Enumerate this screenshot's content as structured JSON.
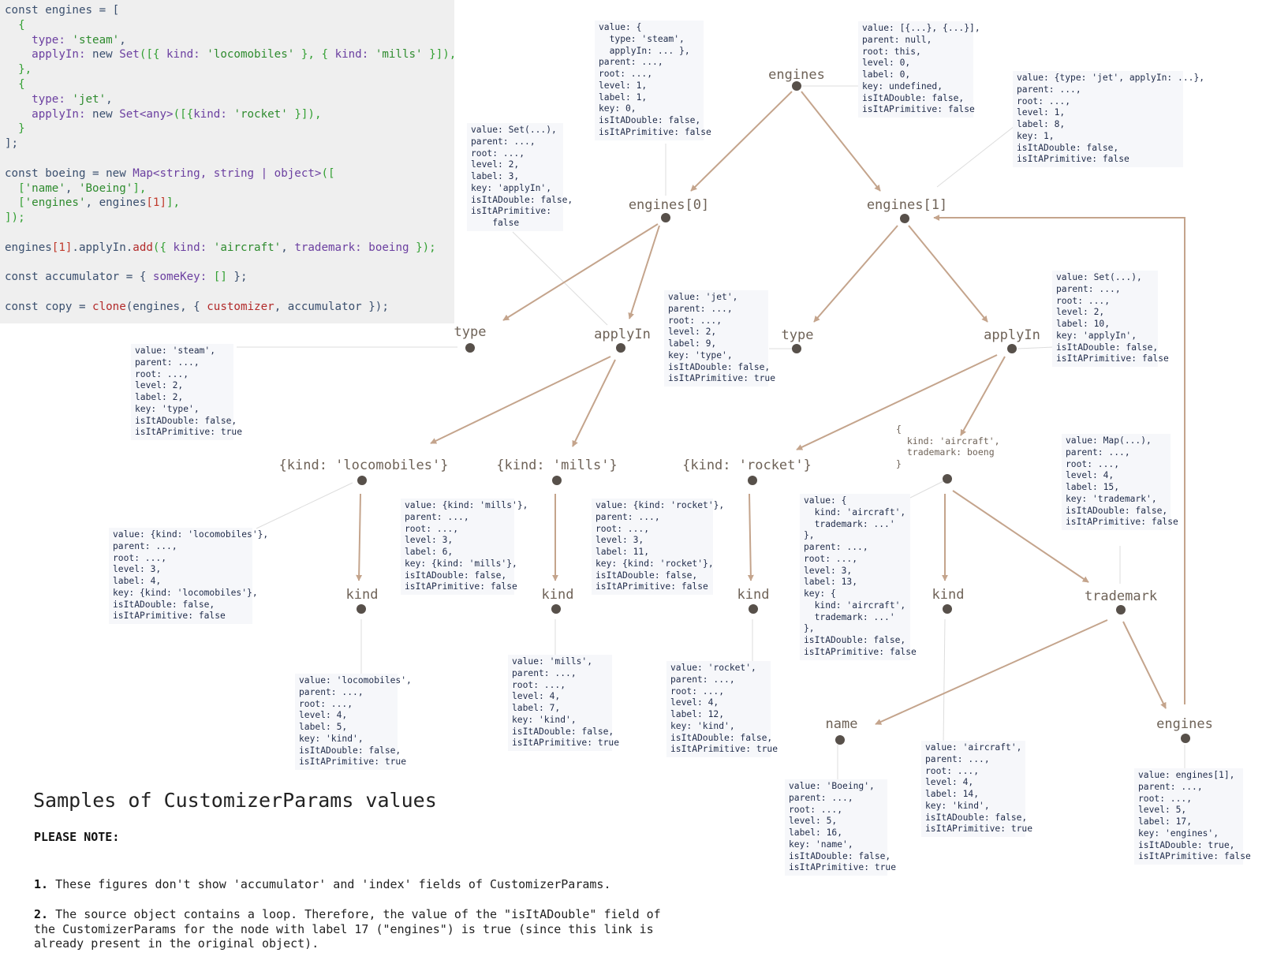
{
  "code": {
    "lines": [
      [
        {
          "t": "const engines = [",
          "c": "#3a4f6e"
        }
      ],
      [
        {
          "t": "  {",
          "c": "#33a033"
        }
      ],
      [
        {
          "t": "    type: ",
          "c": "#6b3fa0"
        },
        {
          "t": "'steam'",
          "c": "#2e8b2e"
        },
        {
          "t": ",",
          "c": "#3a4f6e"
        }
      ],
      [
        {
          "t": "    applyIn: ",
          "c": "#6b3fa0"
        },
        {
          "t": "new ",
          "c": "#3a4f6e"
        },
        {
          "t": "Set",
          "c": "#6b3fa0"
        },
        {
          "t": "([{ ",
          "c": "#33a033"
        },
        {
          "t": "kind: ",
          "c": "#6b3fa0"
        },
        {
          "t": "'locomobiles'",
          "c": "#2e8b2e"
        },
        {
          "t": " }, { ",
          "c": "#33a033"
        },
        {
          "t": "kind: ",
          "c": "#6b3fa0"
        },
        {
          "t": "'mills'",
          "c": "#2e8b2e"
        },
        {
          "t": " }]),",
          "c": "#33a033"
        }
      ],
      [
        {
          "t": "  },",
          "c": "#33a033"
        }
      ],
      [
        {
          "t": "  {",
          "c": "#33a033"
        }
      ],
      [
        {
          "t": "    type: ",
          "c": "#6b3fa0"
        },
        {
          "t": "'jet'",
          "c": "#2e8b2e"
        },
        {
          "t": ",",
          "c": "#3a4f6e"
        }
      ],
      [
        {
          "t": "    applyIn: ",
          "c": "#6b3fa0"
        },
        {
          "t": "new ",
          "c": "#3a4f6e"
        },
        {
          "t": "Set",
          "c": "#6b3fa0"
        },
        {
          "t": "<any>",
          "c": "#6b3fa0"
        },
        {
          "t": "([{",
          "c": "#33a033"
        },
        {
          "t": "kind: ",
          "c": "#6b3fa0"
        },
        {
          "t": "'rocket'",
          "c": "#2e8b2e"
        },
        {
          "t": " }]),",
          "c": "#33a033"
        }
      ],
      [
        {
          "t": "  }",
          "c": "#33a033"
        }
      ],
      [
        {
          "t": "];",
          "c": "#3a4f6e"
        }
      ],
      [
        {
          "t": "",
          "c": "#3a4f6e"
        }
      ],
      [
        {
          "t": "const boeing = ",
          "c": "#3a4f6e"
        },
        {
          "t": "new ",
          "c": "#3a4f6e"
        },
        {
          "t": "Map",
          "c": "#6b3fa0"
        },
        {
          "t": "<string, string | object>",
          "c": "#6b3fa0"
        },
        {
          "t": "([",
          "c": "#33a033"
        }
      ],
      [
        {
          "t": "  [",
          "c": "#33a033"
        },
        {
          "t": "'name'",
          "c": "#2e8b2e"
        },
        {
          "t": ", ",
          "c": "#3a4f6e"
        },
        {
          "t": "'Boeing'",
          "c": "#2e8b2e"
        },
        {
          "t": "],",
          "c": "#33a033"
        }
      ],
      [
        {
          "t": "  [",
          "c": "#33a033"
        },
        {
          "t": "'engines'",
          "c": "#2e8b2e"
        },
        {
          "t": ", engines",
          "c": "#3a4f6e"
        },
        {
          "t": "[1]",
          "c": "#c0392b"
        },
        {
          "t": "],",
          "c": "#33a033"
        }
      ],
      [
        {
          "t": "]);",
          "c": "#33a033"
        }
      ],
      [
        {
          "t": "",
          "c": "#3a4f6e"
        }
      ],
      [
        {
          "t": "engines",
          "c": "#3a4f6e"
        },
        {
          "t": "[1]",
          "c": "#c0392b"
        },
        {
          "t": ".applyIn.",
          "c": "#3a4f6e"
        },
        {
          "t": "add",
          "c": "#b22a2a"
        },
        {
          "t": "({ ",
          "c": "#33a033"
        },
        {
          "t": "kind: ",
          "c": "#6b3fa0"
        },
        {
          "t": "'aircraft'",
          "c": "#2e8b2e"
        },
        {
          "t": ", ",
          "c": "#3a4f6e"
        },
        {
          "t": "trademark: ",
          "c": "#6b3fa0"
        },
        {
          "t": "boeing ",
          "c": "#6b3fa0"
        },
        {
          "t": "});",
          "c": "#33a033"
        }
      ],
      [
        {
          "t": "",
          "c": "#3a4f6e"
        }
      ],
      [
        {
          "t": "const accumulator = { ",
          "c": "#3a4f6e"
        },
        {
          "t": "someKey: ",
          "c": "#6b3fa0"
        },
        {
          "t": "[]",
          "c": "#33a033"
        },
        {
          "t": " };",
          "c": "#3a4f6e"
        }
      ],
      [
        {
          "t": "",
          "c": "#3a4f6e"
        }
      ],
      [
        {
          "t": "const copy = ",
          "c": "#3a4f6e"
        },
        {
          "t": "clone",
          "c": "#b22a2a"
        },
        {
          "t": "(engines, { ",
          "c": "#3a4f6e"
        },
        {
          "t": "customizer",
          "c": "#b22a2a"
        },
        {
          "t": ", accumulator });",
          "c": "#3a4f6e"
        }
      ]
    ]
  },
  "colors": {
    "edge": "#c4a48c",
    "node_dot": "#57504a",
    "node_label": "#6e6257",
    "info_bg": "#f6f7fa",
    "code_bg": "#efefef"
  },
  "nodes": {
    "engines": "engines",
    "engines0": "engines[0]",
    "engines1": "engines[1]",
    "type0": "type",
    "applyIn0": "applyIn",
    "type1": "type",
    "applyIn1": "applyIn",
    "loco": "{kind: 'locomobiles'}",
    "mills": "{kind: 'mills'}",
    "rocket": "{kind: 'rocket'}",
    "aircraft": "{\n  kind: 'aircraft',\n  trademark: boeng\n}",
    "kind_loco": "kind",
    "kind_mills": "kind",
    "kind_rocket": "kind",
    "kind_aircraft": "kind",
    "trademark": "trademark",
    "name": "name",
    "engines_loop": "engines"
  },
  "info": {
    "root": "value: [{...}, {...}],\nparent: null,\nroot: this,\nlevel: 0,\nlabel: 0,\nkey: undefined,\nisItADouble: false,\nisItAPrimitive: false",
    "engines0": "value: {\n  type: 'steam',\n  applyIn: ... },\nparent: ...,\nroot: ...,\nlevel: 1,\nlabel: 1,\nkey: 0,\nisItADouble: false,\nisItAPrimitive: false",
    "engines1": "value: {type: 'jet', applyIn: ...},\nparent: ...,\nroot: ...,\nlevel: 1,\nlabel: 8,\nkey: 1,\nisItADouble: false,\nisItAPrimitive: false",
    "applyIn0": "value: Set(...),\nparent: ...,\nroot: ...,\nlevel: 2,\nlabel: 3,\nkey: 'applyIn',\nisItADouble: false,\nisItAPrimitive:\n    false",
    "type0": "value: 'steam',\nparent: ...,\nroot: ...,\nlevel: 2,\nlabel: 2,\nkey: 'type',\nisItADouble: false,\nisItAPrimitive: true",
    "type1": "value: 'jet',\nparent: ...,\nroot: ...,\nlevel: 2,\nlabel: 9,\nkey: 'type',\nisItADouble: false,\nisItAPrimitive: true",
    "applyIn1": "value: Set(...),\nparent: ...,\nroot: ...,\nlevel: 2,\nlabel: 10,\nkey: 'applyIn',\nisItADouble: false,\nisItAPrimitive: false",
    "loco": "value: {kind: 'locomobiles'},\nparent: ...,\nroot: ...,\nlevel: 3,\nlabel: 4,\nkey: {kind: 'locomobiles'},\nisItADouble: false,\nisItAPrimitive: false",
    "mills": "value: {kind: 'mills'},\nparent: ...,\nroot: ...,\nlevel: 3,\nlabel: 6,\nkey: {kind: 'mills'},\nisItADouble: false,\nisItAPrimitive: false",
    "rocket": "value: {kind: 'rocket'},\nparent: ...,\nroot: ...,\nlevel: 3,\nlabel: 11,\nkey: {kind: 'rocket'},\nisItADouble: false,\nisItAPrimitive: false",
    "aircraft": "value: {\n  kind: 'aircraft',\n  trademark: ...'\n},\nparent: ...,\nroot: ...,\nlevel: 3,\nlabel: 13,\nkey: {\n  kind: 'aircraft',\n  trademark: ...'\n},\nisItADouble: false,\nisItAPrimitive: false",
    "trademark": "value: Map(...),\nparent: ...,\nroot: ...,\nlevel: 4,\nlabel: 15,\nkey: 'trademark',\nisItADouble: false,\nisItAPrimitive: false",
    "kind_loco": "value: 'locomobiles',\nparent: ...,\nroot: ...,\nlevel: 4,\nlabel: 5,\nkey: 'kind',\nisItADouble: false,\nisItAPrimitive: true",
    "kind_mills": "value: 'mills',\nparent: ...,\nroot: ...,\nlevel: 4,\nlabel: 7,\nkey: 'kind',\nisItADouble: false,\nisItAPrimitive: true",
    "kind_rocket": "value: 'rocket',\nparent: ...,\nroot: ...,\nlevel: 4,\nlabel: 12,\nkey: 'kind',\nisItADouble: false,\nisItAPrimitive: true",
    "kind_aircraft": "value: 'aircraft',\nparent: ...,\nroot: ...,\nlevel: 4,\nlabel: 14,\nkey: 'kind',\nisItADouble: false,\nisItAPrimitive: true",
    "name": "value: 'Boeing',\nparent: ...,\nroot: ...,\nlevel: 5,\nlabel: 16,\nkey: 'name',\nisItADouble: false,\nisItAPrimitive: true",
    "engines_loop": "value: engines[1],\nparent: ...,\nroot: ...,\nlevel: 5,\nlabel: 17,\nkey: 'engines',\nisItADouble: true,\nisItAPrimitive: false"
  },
  "caption": {
    "title": "Samples of CustomizerParams values",
    "please_note": "PLEASE NOTE:",
    "note1_num": "1.",
    "note1": "These figures don't show 'accumulator' and 'index' fields of CustomizerParams.",
    "note2_num": "2.",
    "note2": "The source object contains a loop. Therefore, the value of the \"isItADouble\" field of\nthe CustomizerParams for the node with label 17 (\"engines\") is true (since this link is\nalready present in the original object)."
  }
}
